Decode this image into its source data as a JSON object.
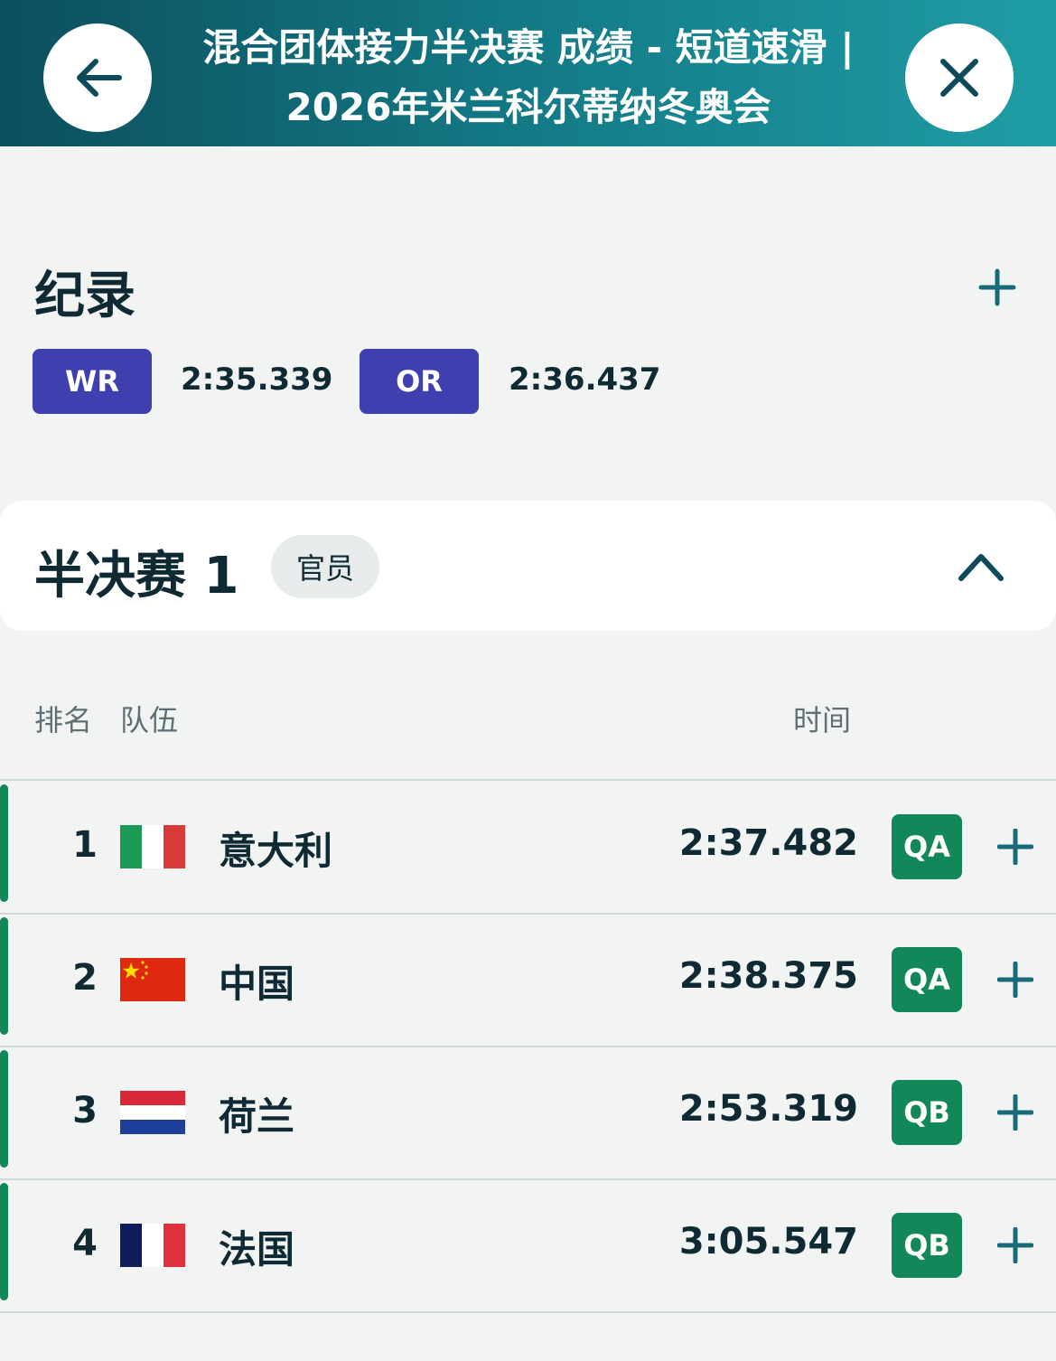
{
  "header": {
    "title_line1": "混合团体接力半决赛 成绩 - 短道速滑 |",
    "title_line2": "2026年米兰科尔蒂纳冬奥会",
    "back_icon": "arrow-left-icon",
    "close_icon": "close-icon"
  },
  "records": {
    "title": "纪录",
    "items": [
      {
        "code": "WR",
        "value": "2:35.339"
      },
      {
        "code": "OR",
        "value": "2:36.437"
      }
    ]
  },
  "semifinal": {
    "title": "半决赛 1",
    "status": "官员"
  },
  "table": {
    "columns": {
      "rank_team": "排名",
      "team": "队伍",
      "time": "时间"
    },
    "rows": [
      {
        "rank": "1",
        "team": "意大利",
        "flag": "italy-flag",
        "time": "2:37.482",
        "qual": "QA"
      },
      {
        "rank": "2",
        "team": "中国",
        "flag": "china-flag",
        "time": "2:38.375",
        "qual": "QA"
      },
      {
        "rank": "3",
        "team": "荷兰",
        "flag": "netherlands-flag",
        "time": "2:53.319",
        "qual": "QB"
      },
      {
        "rank": "4",
        "team": "法国",
        "flag": "france-flag",
        "time": "3:05.547",
        "qual": "QB"
      }
    ]
  },
  "colors": {
    "header_start": "#0c4f5c",
    "header_end": "#1f9da5",
    "record_badge": "#3f3fb0",
    "qualified": "#12875a"
  }
}
